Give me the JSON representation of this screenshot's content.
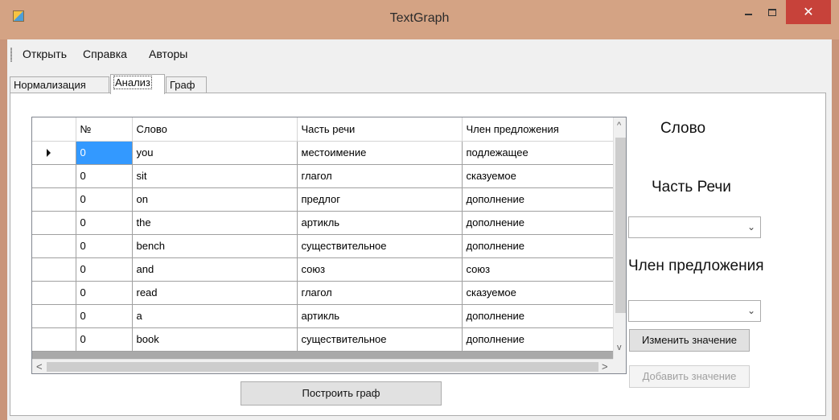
{
  "window": {
    "title": "TextGraph",
    "minimize": "",
    "maximize": "",
    "close": "✕"
  },
  "menu": {
    "items": [
      "Открыть",
      "Справка",
      "Авторы"
    ]
  },
  "tabs": [
    {
      "label": "Нормализация",
      "active": false
    },
    {
      "label": "Анализ",
      "active": true
    },
    {
      "label": "Граф",
      "active": false
    }
  ],
  "grid": {
    "columns": [
      "№",
      "Слово",
      "Часть речи",
      "Член предложения"
    ],
    "rows": [
      [
        "0",
        "you",
        "местоимение",
        "подлежащее"
      ],
      [
        "0",
        "sit",
        "глагол",
        "сказуемое"
      ],
      [
        "0",
        "on",
        "предлог",
        "дополнение"
      ],
      [
        "0",
        "the",
        "артикль",
        "дополнение"
      ],
      [
        "0",
        "bench",
        "существительное",
        "дополнение"
      ],
      [
        "0",
        "and",
        "союз",
        "союз"
      ],
      [
        "0",
        "read",
        "глагол",
        "сказуемое"
      ],
      [
        "0",
        "a",
        "артикль",
        "дополнение"
      ],
      [
        "0",
        "book",
        "существительное",
        "дополнение"
      ]
    ],
    "scroll_up": "^",
    "scroll_down": "v",
    "scroll_left": "<",
    "scroll_right": ">"
  },
  "side": {
    "word_label": "Слово",
    "pos_label": "Часть Речи",
    "member_label": "Член предложения",
    "pos_value": "",
    "member_value": "",
    "change_button": "Изменить значение",
    "add_button": "Добавить значение"
  },
  "build_button": "Построить граф"
}
